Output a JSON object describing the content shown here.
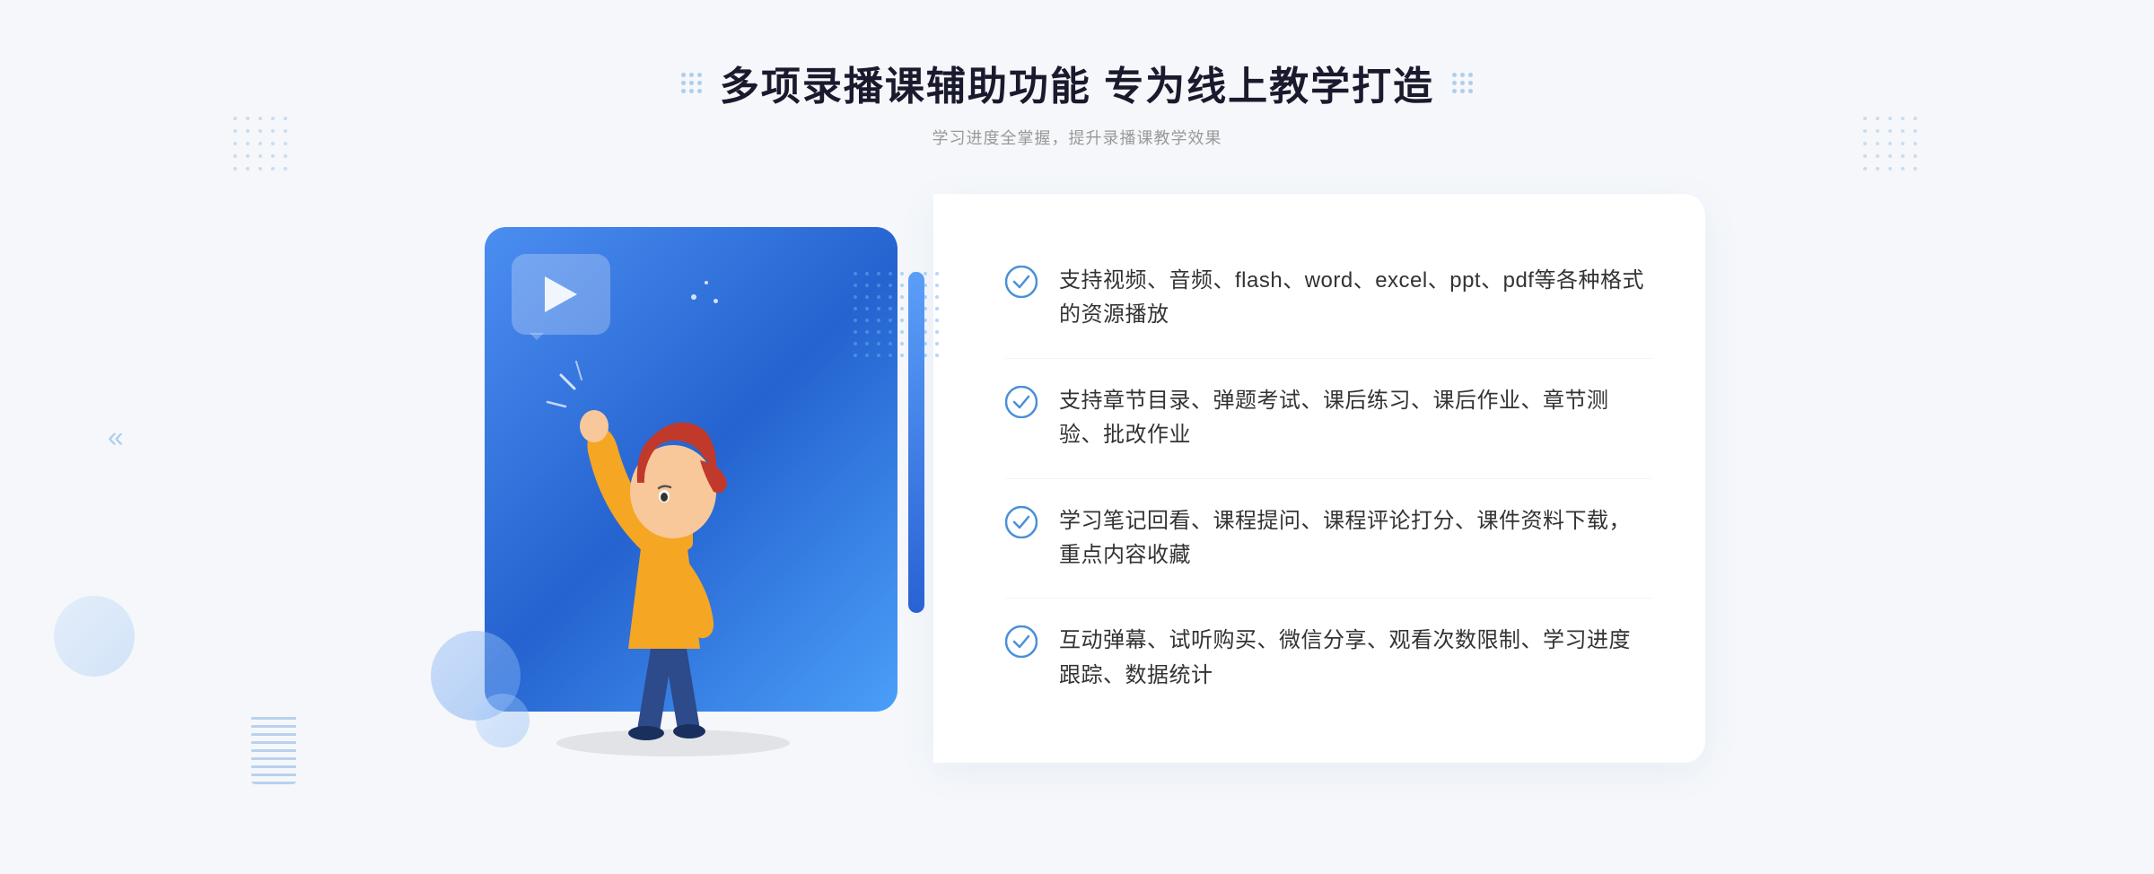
{
  "header": {
    "main_title": "多项录播课辅助功能 专为线上教学打造",
    "subtitle": "学习进度全掌握，提升录播课教学效果"
  },
  "features": [
    {
      "id": 1,
      "text": "支持视频、音频、flash、word、excel、ppt、pdf等各种格式的资源播放"
    },
    {
      "id": 2,
      "text": "支持章节目录、弹题考试、课后练习、课后作业、章节测验、批改作业"
    },
    {
      "id": 3,
      "text": "学习笔记回看、课程提问、课程评论打分、课件资料下载，重点内容收藏"
    },
    {
      "id": 4,
      "text": "互动弹幕、试听购买、微信分享、观看次数限制、学习进度跟踪、数据统计"
    }
  ],
  "illustration": {
    "play_label": "play-button",
    "person_label": "teacher-person"
  },
  "nav": {
    "left_arrow": "«",
    "right_arrow": "»"
  }
}
